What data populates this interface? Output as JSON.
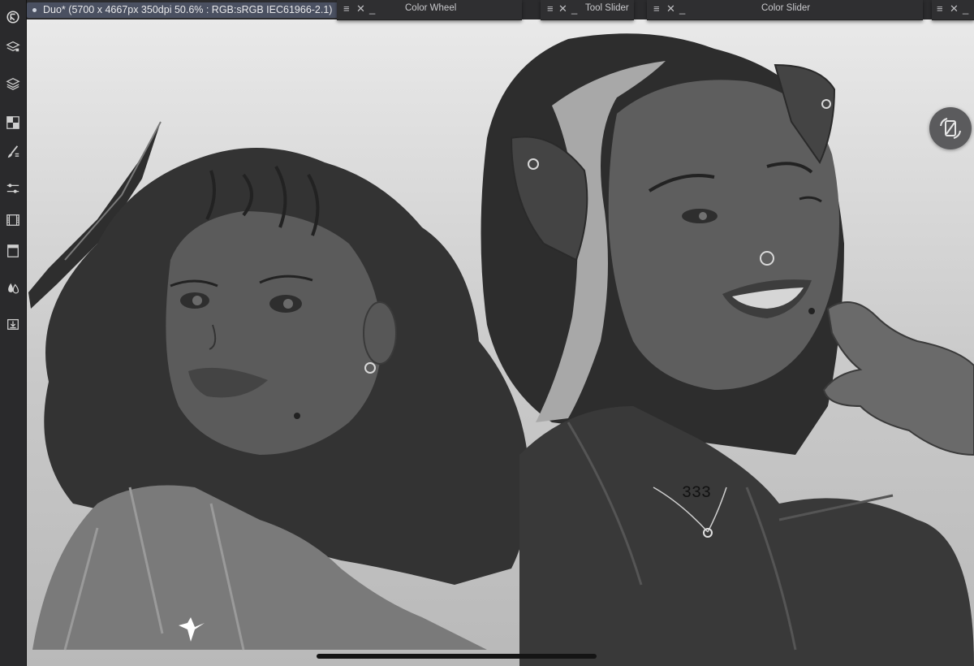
{
  "document": {
    "name": "Duo*",
    "info": "(5700 x 4667px 350dpi 50.6% : RGB:sRGB IEC61966-2.1)"
  },
  "panels": [
    {
      "title": "Color Wheel"
    },
    {
      "title": "Tool Slider"
    },
    {
      "title": "Color Slider"
    }
  ],
  "toolbar": {
    "icons": [
      "app-logo-icon",
      "layer-properties-icon",
      "layers-icon",
      "grid-icon",
      "brush-icon",
      "adjustment-sliders-icon",
      "animation-film-icon",
      "page-icon",
      "color-drops-icon",
      "export-icon"
    ]
  },
  "colors": {
    "accent_tab": "#4a5061",
    "chrome": "#2b2b2d"
  }
}
